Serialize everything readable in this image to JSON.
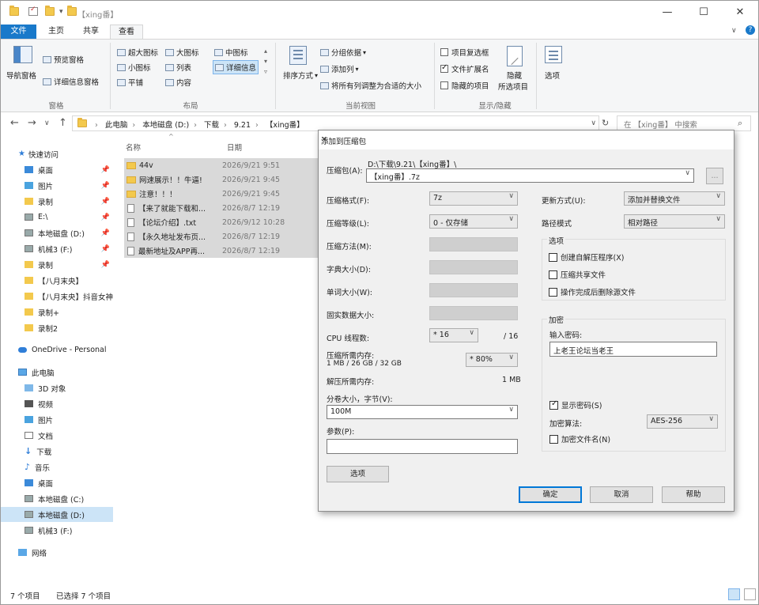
{
  "window": {
    "title": "【xing番】",
    "controls": {
      "minimize": "—",
      "maximize": "☐",
      "close": "✕"
    }
  },
  "ribbon_tabs": [
    "文件",
    "主页",
    "共享",
    "查看"
  ],
  "ribbon": {
    "pane": {
      "nav_pane": "导航窗格",
      "preview_pane": "预览窗格",
      "details_pane": "详细信息窗格",
      "group": "窗格"
    },
    "layout": {
      "items": [
        "超大图标",
        "大图标",
        "中图标",
        "小图标",
        "列表",
        "详细信息",
        "平铺",
        "内容"
      ],
      "group": "布局"
    },
    "current_view": {
      "sort": "排序方式",
      "group_by": "分组依据",
      "add_columns": "添加列",
      "fit_columns": "将所有列调整为合适的大小",
      "group": "当前视图"
    },
    "show_hide": {
      "item_checkboxes": "项目复选框",
      "file_extensions": "文件扩展名",
      "hidden_items": "隐藏的项目",
      "hide_selected": "隐藏",
      "hide_selected2": "所选项目",
      "group": "显示/隐藏",
      "extensions_checked": true
    },
    "options": "选项"
  },
  "address": {
    "crumbs": [
      "此电脑",
      "本地磁盘 (D:)",
      "下载",
      "9.21",
      "【xing番】"
    ],
    "search_placeholder": "在 【xing番】 中搜索"
  },
  "nav": {
    "items": [
      {
        "label": "快速访问",
        "icon": "star-icon",
        "pinned": false
      },
      {
        "label": "桌面",
        "icon": "desktop-icon",
        "pinned": true
      },
      {
        "label": "图片",
        "icon": "pictures-icon",
        "pinned": true
      },
      {
        "label": "录制",
        "icon": "folder-icon",
        "pinned": true
      },
      {
        "label": "E:\\",
        "icon": "drive-icon",
        "pinned": true
      },
      {
        "label": "本地磁盘 (D:)",
        "icon": "drive-icon",
        "pinned": true
      },
      {
        "label": "机械3 (F:)",
        "icon": "drive-icon",
        "pinned": true
      },
      {
        "label": "录制",
        "icon": "folder-icon",
        "pinned": true
      },
      {
        "label": "【八月末央】",
        "icon": "folder-icon",
        "pinned": false
      },
      {
        "label": "【八月末央】抖音女神",
        "icon": "folder-icon",
        "pinned": false
      },
      {
        "label": "录制+",
        "icon": "folder-icon",
        "pinned": false
      },
      {
        "label": "录制2",
        "icon": "folder-icon",
        "pinned": false
      },
      {
        "label": "OneDrive - Personal",
        "icon": "cloud-icon",
        "pinned": false
      },
      {
        "label": "此电脑",
        "icon": "computer-icon",
        "pinned": false
      },
      {
        "label": "3D 对象",
        "icon": "cube-icon",
        "pinned": false
      },
      {
        "label": "视频",
        "icon": "video-icon",
        "pinned": false
      },
      {
        "label": "图片",
        "icon": "pictures-icon",
        "pinned": false
      },
      {
        "label": "文档",
        "icon": "document-icon",
        "pinned": false
      },
      {
        "label": "下载",
        "icon": "download-icon",
        "pinned": false
      },
      {
        "label": "音乐",
        "icon": "music-icon",
        "pinned": false
      },
      {
        "label": "桌面",
        "icon": "desktop-icon",
        "pinned": false
      },
      {
        "label": "本地磁盘 (C:)",
        "icon": "drive-icon",
        "pinned": false
      },
      {
        "label": "本地磁盘 (D:)",
        "icon": "drive-icon",
        "pinned": false
      },
      {
        "label": "机械3 (F:)",
        "icon": "drive-icon",
        "pinned": false
      },
      {
        "label": "网络",
        "icon": "network-icon",
        "pinned": false
      }
    ]
  },
  "file_list": {
    "columns": [
      "名称",
      "日期"
    ],
    "rows": [
      {
        "name": "44v",
        "date": "2026/9/21 9:51",
        "type": "folder"
      },
      {
        "name": "网速展示！！牛逼!",
        "date": "2026/9/21 9:45",
        "type": "folder"
      },
      {
        "name": "注意！！！",
        "date": "2026/9/21 9:45",
        "type": "folder"
      },
      {
        "name": "【来了就能下载和...",
        "date": "2026/8/7 12:19",
        "type": "file"
      },
      {
        "name": "【论坛介绍】.txt",
        "date": "2026/9/12 10:28",
        "type": "file"
      },
      {
        "name": "【永久地址发布页...",
        "date": "2026/8/7 12:19",
        "type": "file"
      },
      {
        "name": "最新地址及APP再...",
        "date": "2026/8/7 12:19",
        "type": "file"
      }
    ]
  },
  "status": {
    "count": "7 个项目",
    "selected": "已选择 7 个项目"
  },
  "dialog": {
    "title": "添加到压缩包",
    "archive_label": "压缩包(A):",
    "archive_path": "D:\\下载\\9.21\\【xing番】\\",
    "archive_name": "【xing番】.7z",
    "browse": "...",
    "format_label": "压缩格式(F):",
    "format": "7z",
    "level_label": "压缩等级(L):",
    "level": "0 - 仅存储",
    "method_label": "压缩方法(M):",
    "dict_label": "字典大小(D):",
    "word_label": "单词大小(W):",
    "solid_label": "固实数据大小:",
    "threads_label": "CPU 线程数:",
    "threads": "* 16",
    "threads_max": "/ 16",
    "mem_label": "压缩所需内存:",
    "mem_value": "1 MB / 26 GB / 32 GB",
    "mem_percent": "* 80%",
    "decomp_label": "解压所需内存:",
    "decomp_value": "1 MB",
    "split_label": "分卷大小，字节(V):",
    "split": "100M",
    "params_label": "参数(P):",
    "params": "",
    "options_btn": "选项",
    "update_label": "更新方式(U):",
    "update": "添加并替换文件",
    "path_label": "路径模式",
    "path": "相对路径",
    "opts_group": "选项",
    "opts": [
      {
        "label": "创建自解压程序(X)",
        "checked": false
      },
      {
        "label": "压缩共享文件",
        "checked": false
      },
      {
        "label": "操作完成后删除源文件",
        "checked": false
      }
    ],
    "enc_group": "加密",
    "pwd_label": "输入密码:",
    "pwd": "上老王论坛当老王",
    "show_pwd": "显示密码(S)",
    "show_pwd_checked": true,
    "enc_method_label": "加密算法:",
    "enc_method": "AES-256",
    "enc_names": "加密文件名(N)",
    "enc_names_checked": false,
    "ok": "确定",
    "cancel": "取消",
    "help": "帮助"
  }
}
